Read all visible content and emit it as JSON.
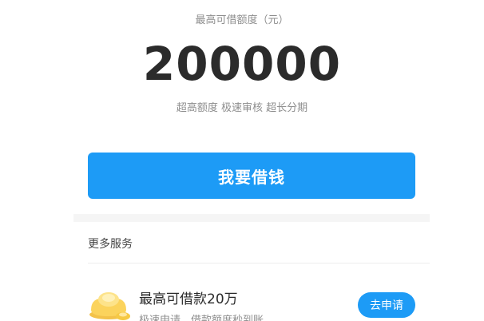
{
  "loan": {
    "title": "最高可借额度（元）",
    "amount": "200000",
    "subtitle": "超高额度 极速审核 超长分期",
    "borrow_label": "我要借钱"
  },
  "more_services": {
    "title": "更多服务",
    "items": [
      {
        "icon": "gold-ingot-icon",
        "title": "最高可借款20万",
        "desc": "极速申请，借款额度秒到账",
        "button_label": "去申请"
      }
    ]
  },
  "colors": {
    "accent": "#1d9bf6",
    "text_primary": "#2b2b2b",
    "text_secondary": "#8e8e8e"
  }
}
